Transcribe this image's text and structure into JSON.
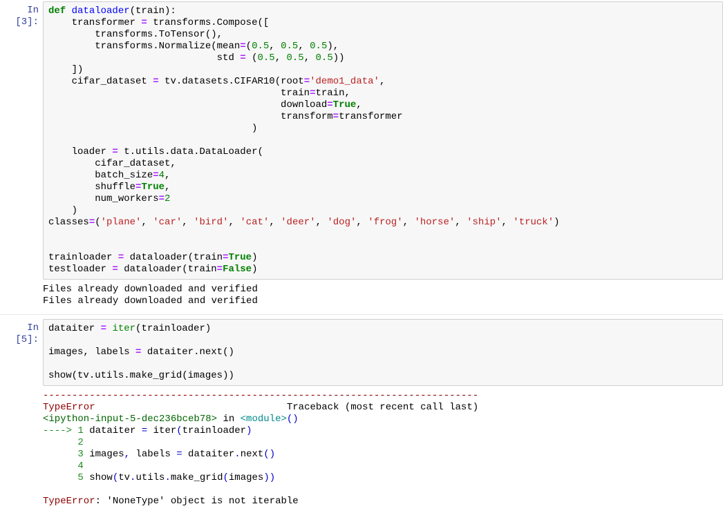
{
  "cells": [
    {
      "prompt": "In [3]:",
      "code_lines": [
        [
          {
            "t": "def ",
            "c": "c-keyword"
          },
          {
            "t": "dataloader",
            "c": "c-def"
          },
          {
            "t": "(train):",
            "c": "c-punc"
          }
        ],
        [
          {
            "t": "    transformer ",
            "c": "c-name"
          },
          {
            "t": "= ",
            "c": "c-op"
          },
          {
            "t": "transforms",
            "c": "c-name"
          },
          {
            "t": ".",
            "c": "c-punc"
          },
          {
            "t": "Compose([",
            "c": "c-name"
          }
        ],
        [
          {
            "t": "        transforms",
            "c": "c-name"
          },
          {
            "t": ".",
            "c": "c-punc"
          },
          {
            "t": "ToTensor(),",
            "c": "c-name"
          }
        ],
        [
          {
            "t": "        transforms",
            "c": "c-name"
          },
          {
            "t": ".",
            "c": "c-punc"
          },
          {
            "t": "Normalize(mean",
            "c": "c-name"
          },
          {
            "t": "=",
            "c": "c-op"
          },
          {
            "t": "(",
            "c": "c-punc"
          },
          {
            "t": "0.5",
            "c": "c-num"
          },
          {
            "t": ", ",
            "c": "c-punc"
          },
          {
            "t": "0.5",
            "c": "c-num"
          },
          {
            "t": ", ",
            "c": "c-punc"
          },
          {
            "t": "0.5",
            "c": "c-num"
          },
          {
            "t": "),",
            "c": "c-punc"
          }
        ],
        [
          {
            "t": "                             std ",
            "c": "c-name"
          },
          {
            "t": "= ",
            "c": "c-op"
          },
          {
            "t": "(",
            "c": "c-punc"
          },
          {
            "t": "0.5",
            "c": "c-num"
          },
          {
            "t": ", ",
            "c": "c-punc"
          },
          {
            "t": "0.5",
            "c": "c-num"
          },
          {
            "t": ", ",
            "c": "c-punc"
          },
          {
            "t": "0.5",
            "c": "c-num"
          },
          {
            "t": "))",
            "c": "c-punc"
          }
        ],
        [
          {
            "t": "    ])",
            "c": "c-punc"
          }
        ],
        [
          {
            "t": "    cifar_dataset ",
            "c": "c-name"
          },
          {
            "t": "= ",
            "c": "c-op"
          },
          {
            "t": "tv",
            "c": "c-name"
          },
          {
            "t": ".",
            "c": "c-punc"
          },
          {
            "t": "datasets",
            "c": "c-name"
          },
          {
            "t": ".",
            "c": "c-punc"
          },
          {
            "t": "CIFAR10(root",
            "c": "c-name"
          },
          {
            "t": "=",
            "c": "c-op"
          },
          {
            "t": "'demo1_data'",
            "c": "c-str"
          },
          {
            "t": ",",
            "c": "c-punc"
          }
        ],
        [
          {
            "t": "                                        train",
            "c": "c-name"
          },
          {
            "t": "=",
            "c": "c-op"
          },
          {
            "t": "train,",
            "c": "c-name"
          }
        ],
        [
          {
            "t": "                                        download",
            "c": "c-name"
          },
          {
            "t": "=",
            "c": "c-op"
          },
          {
            "t": "True",
            "c": "c-keyword"
          },
          {
            "t": ",",
            "c": "c-punc"
          }
        ],
        [
          {
            "t": "                                        transform",
            "c": "c-name"
          },
          {
            "t": "=",
            "c": "c-op"
          },
          {
            "t": "transformer",
            "c": "c-name"
          }
        ],
        [
          {
            "t": "                                   )",
            "c": "c-punc"
          }
        ],
        [
          {
            "t": " ",
            "c": "c-punc"
          }
        ],
        [
          {
            "t": "    loader ",
            "c": "c-name"
          },
          {
            "t": "= ",
            "c": "c-op"
          },
          {
            "t": "t",
            "c": "c-name"
          },
          {
            "t": ".",
            "c": "c-punc"
          },
          {
            "t": "utils",
            "c": "c-name"
          },
          {
            "t": ".",
            "c": "c-punc"
          },
          {
            "t": "data",
            "c": "c-name"
          },
          {
            "t": ".",
            "c": "c-punc"
          },
          {
            "t": "DataLoader(",
            "c": "c-name"
          }
        ],
        [
          {
            "t": "        cifar_dataset,",
            "c": "c-name"
          }
        ],
        [
          {
            "t": "        batch_size",
            "c": "c-name"
          },
          {
            "t": "=",
            "c": "c-op"
          },
          {
            "t": "4",
            "c": "c-num"
          },
          {
            "t": ",",
            "c": "c-punc"
          }
        ],
        [
          {
            "t": "        shuffle",
            "c": "c-name"
          },
          {
            "t": "=",
            "c": "c-op"
          },
          {
            "t": "True",
            "c": "c-keyword"
          },
          {
            "t": ",",
            "c": "c-punc"
          }
        ],
        [
          {
            "t": "        num_workers",
            "c": "c-name"
          },
          {
            "t": "=",
            "c": "c-op"
          },
          {
            "t": "2",
            "c": "c-num"
          }
        ],
        [
          {
            "t": "    )",
            "c": "c-punc"
          }
        ],
        [
          {
            "t": "classes",
            "c": "c-name"
          },
          {
            "t": "=",
            "c": "c-op"
          },
          {
            "t": "(",
            "c": "c-punc"
          },
          {
            "t": "'plane'",
            "c": "c-str"
          },
          {
            "t": ", ",
            "c": "c-punc"
          },
          {
            "t": "'car'",
            "c": "c-str"
          },
          {
            "t": ", ",
            "c": "c-punc"
          },
          {
            "t": "'bird'",
            "c": "c-str"
          },
          {
            "t": ", ",
            "c": "c-punc"
          },
          {
            "t": "'cat'",
            "c": "c-str"
          },
          {
            "t": ", ",
            "c": "c-punc"
          },
          {
            "t": "'deer'",
            "c": "c-str"
          },
          {
            "t": ", ",
            "c": "c-punc"
          },
          {
            "t": "'dog'",
            "c": "c-str"
          },
          {
            "t": ", ",
            "c": "c-punc"
          },
          {
            "t": "'frog'",
            "c": "c-str"
          },
          {
            "t": ", ",
            "c": "c-punc"
          },
          {
            "t": "'horse'",
            "c": "c-str"
          },
          {
            "t": ", ",
            "c": "c-punc"
          },
          {
            "t": "'ship'",
            "c": "c-str"
          },
          {
            "t": ", ",
            "c": "c-punc"
          },
          {
            "t": "'truck'",
            "c": "c-str"
          },
          {
            "t": ")",
            "c": "c-punc"
          }
        ],
        [
          {
            "t": " ",
            "c": "c-punc"
          }
        ],
        [
          {
            "t": " ",
            "c": "c-punc"
          }
        ],
        [
          {
            "t": "trainloader ",
            "c": "c-name"
          },
          {
            "t": "= ",
            "c": "c-op"
          },
          {
            "t": "dataloader(train",
            "c": "c-name"
          },
          {
            "t": "=",
            "c": "c-op"
          },
          {
            "t": "True",
            "c": "c-keyword"
          },
          {
            "t": ")",
            "c": "c-punc"
          }
        ],
        [
          {
            "t": "testloader ",
            "c": "c-name"
          },
          {
            "t": "= ",
            "c": "c-op"
          },
          {
            "t": "dataloader(train",
            "c": "c-name"
          },
          {
            "t": "=",
            "c": "c-op"
          },
          {
            "t": "False",
            "c": "c-keyword"
          },
          {
            "t": ")",
            "c": "c-punc"
          }
        ]
      ],
      "output_lines": [
        [
          {
            "t": "Files already downloaded and verified",
            "c": ""
          }
        ],
        [
          {
            "t": "Files already downloaded and verified",
            "c": ""
          }
        ]
      ]
    },
    {
      "prompt": "In [5]:",
      "code_lines": [
        [
          {
            "t": "dataiter ",
            "c": "c-name"
          },
          {
            "t": "= ",
            "c": "c-op"
          },
          {
            "t": "iter",
            "c": "c-builtin"
          },
          {
            "t": "(trainloader)",
            "c": "c-name"
          }
        ],
        [
          {
            "t": " ",
            "c": "c-punc"
          }
        ],
        [
          {
            "t": "images, labels ",
            "c": "c-name"
          },
          {
            "t": "= ",
            "c": "c-op"
          },
          {
            "t": "dataiter",
            "c": "c-name"
          },
          {
            "t": ".",
            "c": "c-punc"
          },
          {
            "t": "next()",
            "c": "c-name"
          }
        ],
        [
          {
            "t": " ",
            "c": "c-punc"
          }
        ],
        [
          {
            "t": "show(tv",
            "c": "c-name"
          },
          {
            "t": ".",
            "c": "c-punc"
          },
          {
            "t": "utils",
            "c": "c-name"
          },
          {
            "t": ".",
            "c": "c-punc"
          },
          {
            "t": "make_grid(images))",
            "c": "c-name"
          }
        ]
      ],
      "output_lines": [
        [
          {
            "t": "---------------------------------------------------------------------------",
            "c": "tb-red"
          }
        ],
        [
          {
            "t": "TypeError",
            "c": "tb-red"
          },
          {
            "t": "                                 Traceback (most recent call last)",
            "c": ""
          }
        ],
        [
          {
            "t": "<ipython-input-5-dec236bceb78>",
            "c": "tb-green"
          },
          {
            "t": " in ",
            "c": ""
          },
          {
            "t": "<module>",
            "c": "tb-cyan"
          },
          {
            "t": "()",
            "c": "tb-blue"
          }
        ],
        [
          {
            "t": "----> 1",
            "c": "tb-lightgreen"
          },
          {
            "t": " dataiter ",
            "c": ""
          },
          {
            "t": "=",
            "c": "tb-blue"
          },
          {
            "t": " iter",
            "c": ""
          },
          {
            "t": "(",
            "c": "tb-blue"
          },
          {
            "t": "trainloader",
            "c": ""
          },
          {
            "t": ")",
            "c": "tb-blue"
          }
        ],
        [
          {
            "t": "      2",
            "c": "tb-lightgreen"
          },
          {
            "t": " ",
            "c": ""
          }
        ],
        [
          {
            "t": "      3",
            "c": "tb-lightgreen"
          },
          {
            "t": " images",
            "c": ""
          },
          {
            "t": ",",
            "c": "tb-blue"
          },
          {
            "t": " labels ",
            "c": ""
          },
          {
            "t": "=",
            "c": "tb-blue"
          },
          {
            "t": " dataiter",
            "c": ""
          },
          {
            "t": ".",
            "c": "tb-blue"
          },
          {
            "t": "next",
            "c": ""
          },
          {
            "t": "()",
            "c": "tb-blue"
          }
        ],
        [
          {
            "t": "      4",
            "c": "tb-lightgreen"
          },
          {
            "t": " ",
            "c": ""
          }
        ],
        [
          {
            "t": "      5",
            "c": "tb-lightgreen"
          },
          {
            "t": " show",
            "c": ""
          },
          {
            "t": "(",
            "c": "tb-blue"
          },
          {
            "t": "tv",
            "c": ""
          },
          {
            "t": ".",
            "c": "tb-blue"
          },
          {
            "t": "utils",
            "c": ""
          },
          {
            "t": ".",
            "c": "tb-blue"
          },
          {
            "t": "make_grid",
            "c": ""
          },
          {
            "t": "(",
            "c": "tb-blue"
          },
          {
            "t": "images",
            "c": ""
          },
          {
            "t": "))",
            "c": "tb-blue"
          }
        ],
        [
          {
            "t": " ",
            "c": ""
          }
        ],
        [
          {
            "t": "TypeError",
            "c": "tb-red"
          },
          {
            "t": ": 'NoneType' object is not iterable",
            "c": ""
          }
        ]
      ]
    }
  ]
}
